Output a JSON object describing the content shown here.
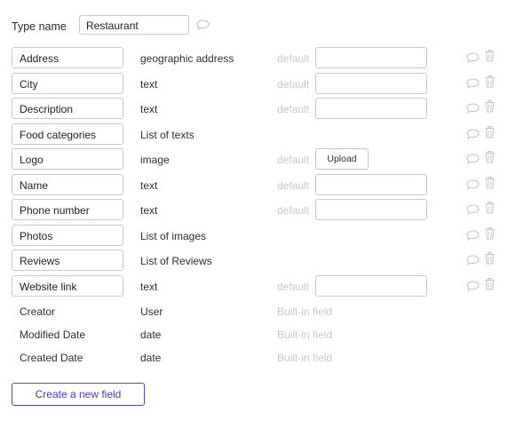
{
  "type_name": {
    "label": "Type name",
    "value": "Restaurant"
  },
  "default_label": "default",
  "builtin_label": "Built-in field",
  "upload_label": "Upload",
  "fields": [
    {
      "name": "Address",
      "type": "geographic address"
    },
    {
      "name": "City",
      "type": "text"
    },
    {
      "name": "Description",
      "type": "text"
    },
    {
      "name": "Food categories",
      "type": "List of texts"
    },
    {
      "name": "Logo",
      "type": "image"
    },
    {
      "name": "Name",
      "type": "text"
    },
    {
      "name": "Phone number",
      "type": "text"
    },
    {
      "name": "Photos",
      "type": "List of images"
    },
    {
      "name": "Reviews",
      "type": "List of Reviews"
    },
    {
      "name": "Website link",
      "type": "text"
    }
  ],
  "builtin_fields": [
    {
      "name": "Creator",
      "type": "User"
    },
    {
      "name": "Modified Date",
      "type": "date"
    },
    {
      "name": "Created Date",
      "type": "date"
    }
  ],
  "create_button_label": "Create a new field",
  "colors": {
    "accent": "#5b3fd6",
    "muted": "#c8c8c8",
    "border": "#c9c9c9"
  }
}
